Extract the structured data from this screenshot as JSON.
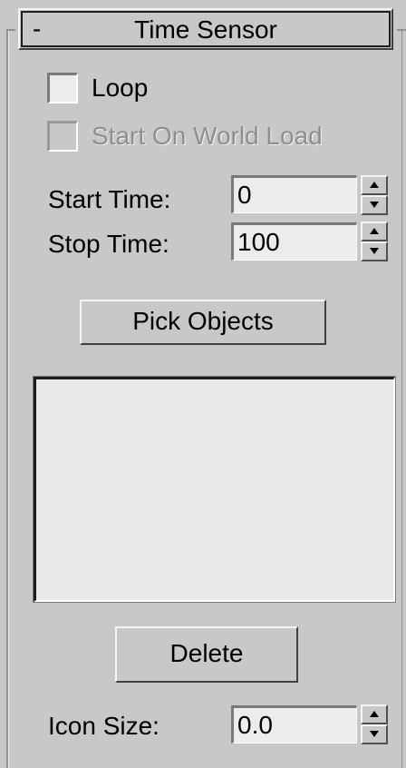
{
  "rollout": {
    "toggle_symbol": "-",
    "title": "Time Sensor"
  },
  "options": {
    "loop": {
      "label": "Loop",
      "checked": false,
      "enabled": true
    },
    "start_on_world_load": {
      "label": "Start On World Load",
      "checked": false,
      "enabled": false
    }
  },
  "timing": {
    "start_time": {
      "label": "Start Time:",
      "value": "0"
    },
    "stop_time": {
      "label": "Stop Time:",
      "value": "100"
    }
  },
  "objects": {
    "pick_label": "Pick Objects",
    "items": [],
    "delete_label": "Delete"
  },
  "icon": {
    "size_label": "Icon Size:",
    "size_value": "0.0"
  },
  "colors": {
    "panel_bg": "#c8c8c8",
    "field_bg": "#ececec",
    "disabled_text": "#8e8e8e"
  }
}
